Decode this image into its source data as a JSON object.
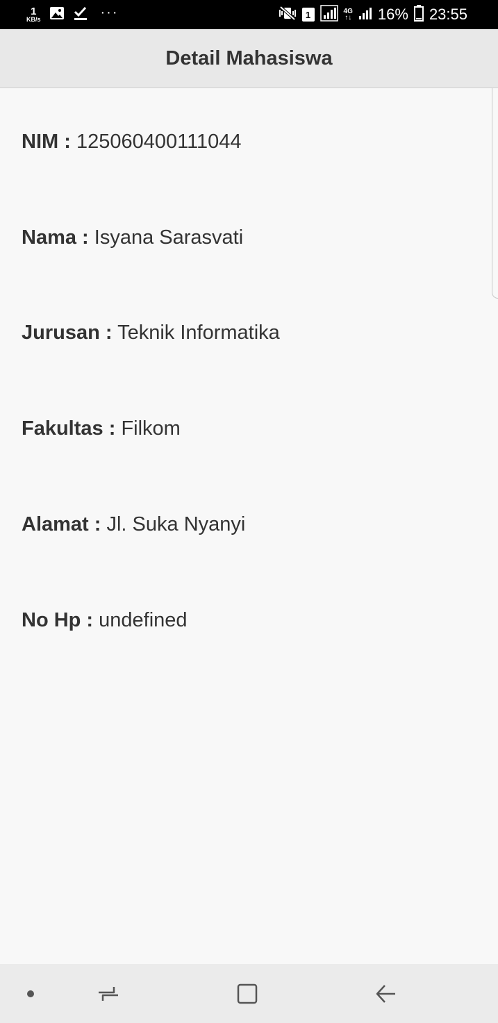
{
  "status_bar": {
    "net_speed_value": "1",
    "net_speed_unit": "KB/s",
    "sim_slot": "1",
    "network_type_top": "4G",
    "network_type_bottom": "↑↓",
    "battery": "16%",
    "time": "23:55",
    "icons": [
      "gallery-icon",
      "check-icon",
      "more-dots-icon",
      "mute-vibrate-icon",
      "sim-icon",
      "signal-icon",
      "battery-icon"
    ]
  },
  "header": {
    "title": "Detail Mahasiswa"
  },
  "details": [
    {
      "label": "NIM :",
      "value": "125060400111044"
    },
    {
      "label": "Nama :",
      "value": "Isyana Sarasvati"
    },
    {
      "label": "Jurusan :",
      "value": "Teknik Informatika"
    },
    {
      "label": "Fakultas :",
      "value": "Filkom"
    },
    {
      "label": "Alamat :",
      "value": "Jl. Suka Nyanyi"
    },
    {
      "label": "No Hp :",
      "value": "undefined"
    }
  ],
  "nav_bar": {
    "icons": [
      "dot-icon",
      "recent-apps-icon",
      "home-icon",
      "back-icon"
    ]
  }
}
